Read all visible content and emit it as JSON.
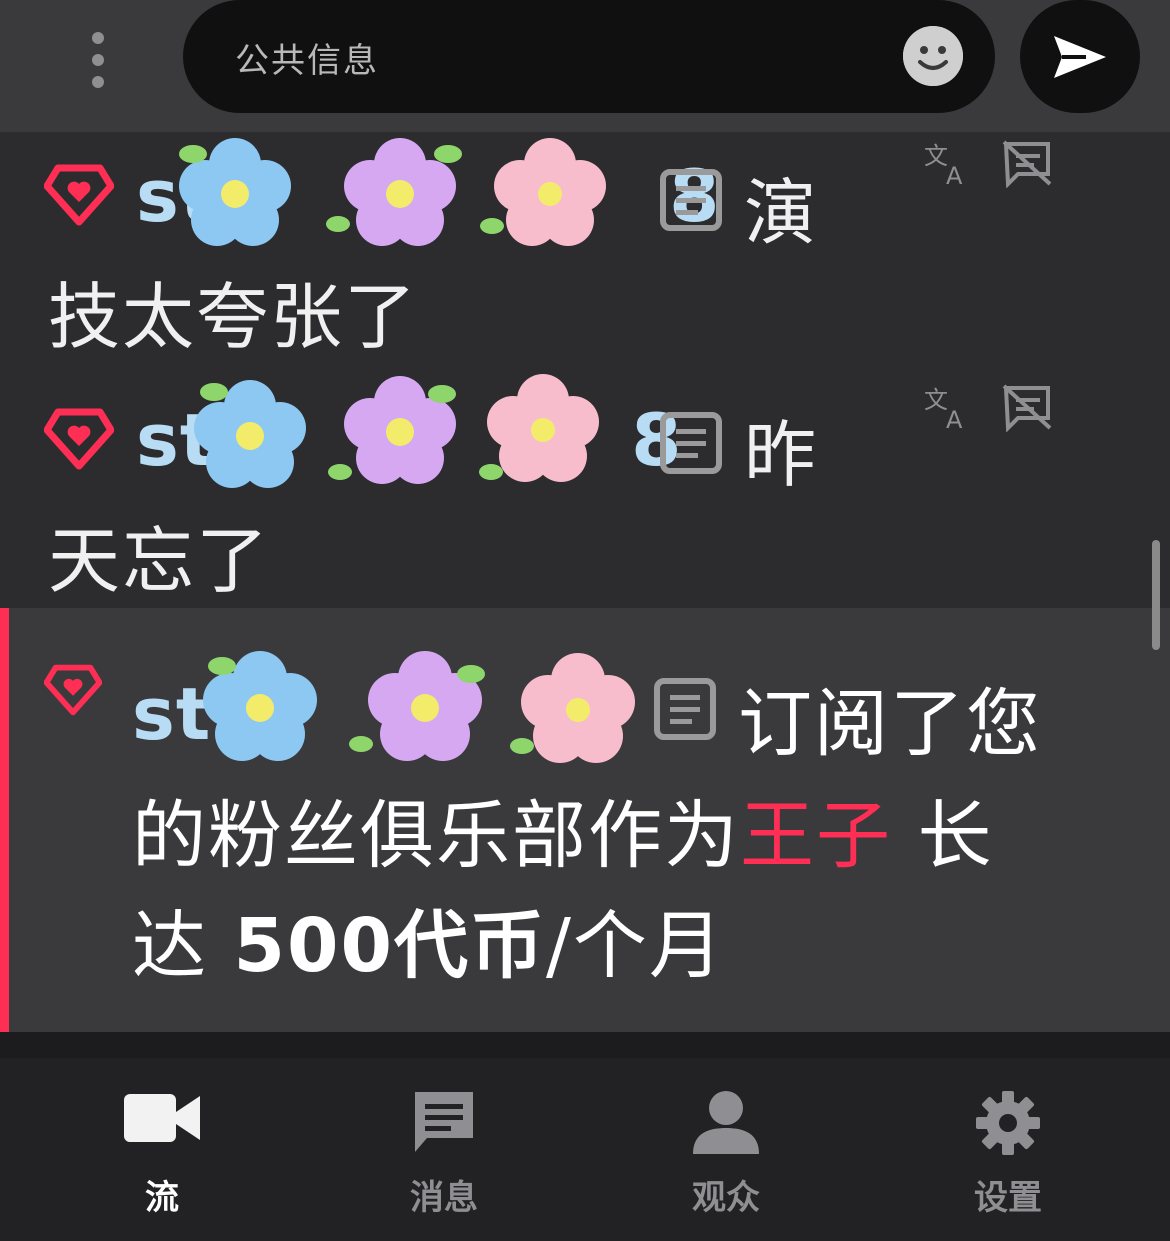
{
  "input": {
    "placeholder": "公共信息"
  },
  "messages": [
    {
      "username_visible": "st",
      "username_tail": "8",
      "line1": "演",
      "line2": "技太夸张了"
    },
    {
      "username_visible": "st",
      "username_tail": "8",
      "line1": "昨",
      "line2": "天忘了"
    },
    {
      "username_visible": "st",
      "line1": "订阅了您",
      "line2_a": "的粉丝俱乐部作为",
      "line2_b": "王子",
      "line2_c": " 长",
      "line3_a": "达 ",
      "line3_b": "500代币",
      "line3_c": "/个月"
    }
  ],
  "nav": [
    {
      "label": "流",
      "icon": "video-camera-icon",
      "active": true
    },
    {
      "label": "消息",
      "icon": "message-icon",
      "active": false
    },
    {
      "label": "观众",
      "icon": "person-icon",
      "active": false
    },
    {
      "label": "设置",
      "icon": "gear-icon",
      "active": false
    }
  ],
  "colors": {
    "accent": "#ff2e55",
    "username": "#b9dcf5",
    "background": "#2c2c2e"
  }
}
